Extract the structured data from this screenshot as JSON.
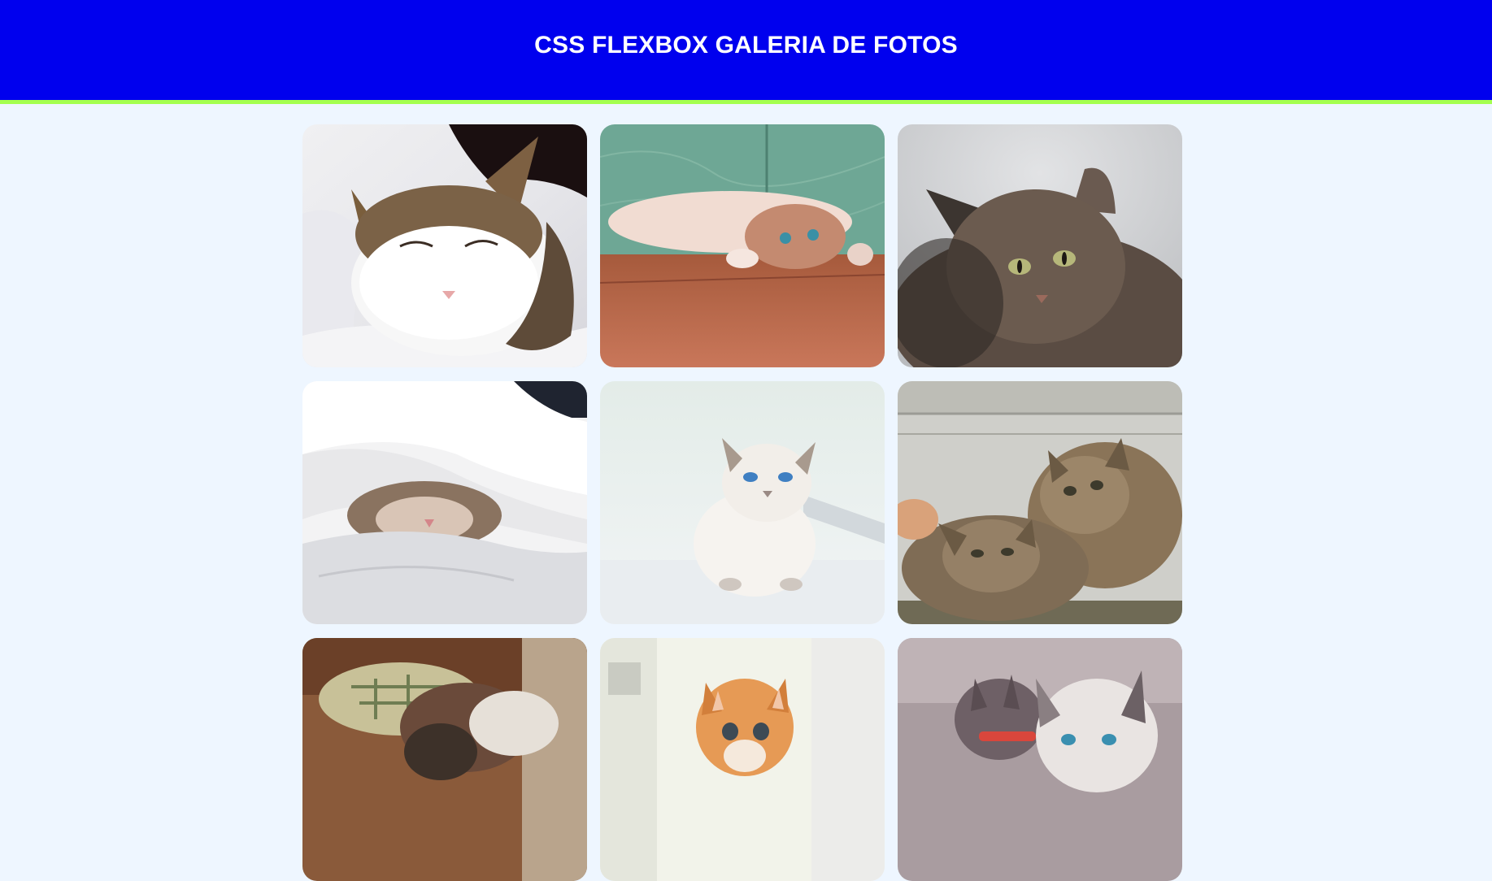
{
  "header": {
    "title": "CSS FLEXBOX GALERIA DE FOTOS",
    "background": "#0000ee",
    "border_color": "#a4ff4f"
  },
  "gallery": {
    "photos": [
      {
        "name": "sleeping-tabby-white-cat-photo",
        "subject": "sleeping tabby-and-white cat"
      },
      {
        "name": "cat-lying-on-wood-floor-photo",
        "subject": "cat lying upside down on wooden floor"
      },
      {
        "name": "long-haired-tabby-cat-photo",
        "subject": "long-haired tabby cat"
      },
      {
        "name": "cat-under-blanket-photo",
        "subject": "cat sleeping under white blanket"
      },
      {
        "name": "white-kitten-blue-eyes-photo",
        "subject": "white kitten with blue eyes"
      },
      {
        "name": "two-tabby-kittens-photo",
        "subject": "two tabby kittens"
      },
      {
        "name": "kitten-with-pillow-photo",
        "subject": "kitten beside a pillow"
      },
      {
        "name": "orange-kitten-photo",
        "subject": "orange kitten"
      },
      {
        "name": "white-grey-kittens-photo",
        "subject": "grey and white kittens"
      }
    ]
  }
}
